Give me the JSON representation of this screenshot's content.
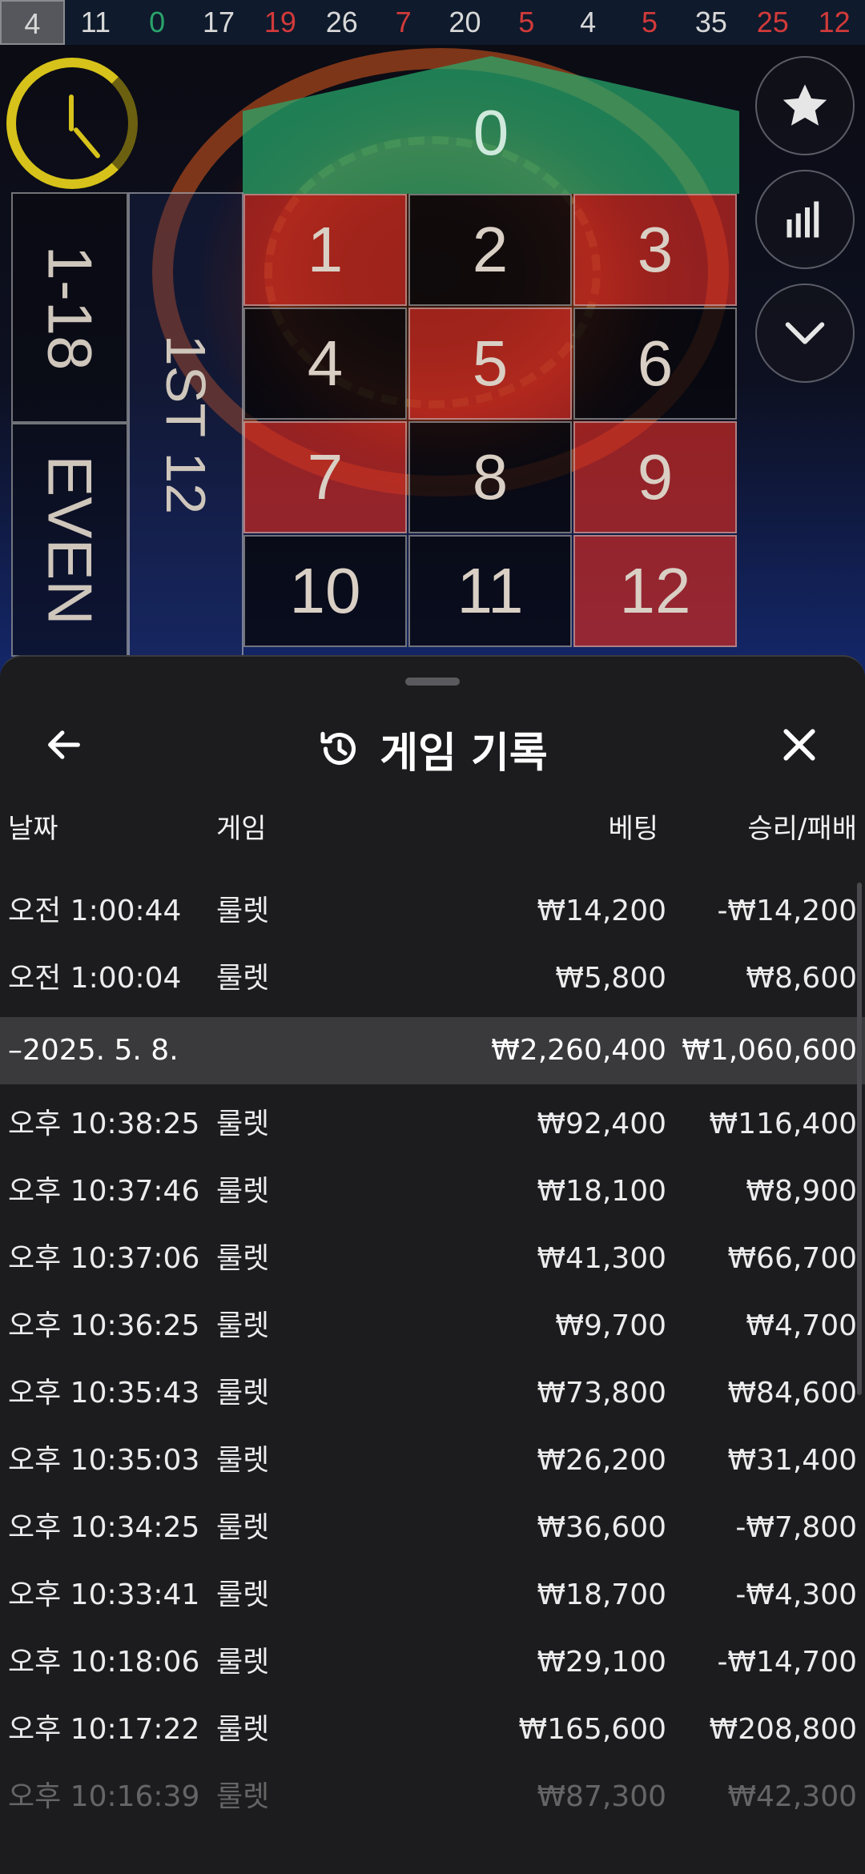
{
  "history": [
    "4",
    "11",
    "0",
    "17",
    "19",
    "26",
    "7",
    "20",
    "5",
    "4",
    "5",
    "35",
    "25",
    "12"
  ],
  "history_colors": [
    "#d8d8d8",
    "#d8d8d8",
    "#2aa36b",
    "#d8d8d8",
    "#d23a3a",
    "#d8d8d8",
    "#d23a3a",
    "#d8d8d8",
    "#d23a3a",
    "#d8d8d8",
    "#d23a3a",
    "#d8d8d8",
    "#d23a3a",
    "#d23a3a"
  ],
  "table": {
    "zero": "0",
    "n1": "1",
    "n2": "2",
    "n3": "3",
    "n4": "4",
    "n5": "5",
    "n6": "6",
    "n7": "7",
    "n8": "8",
    "n9": "9",
    "n10": "10",
    "n11": "11",
    "n12": "12",
    "low": "1-18",
    "even": "EVEN",
    "dozen": "1ST 12"
  },
  "icons": {
    "timer": "clock-icon",
    "favorite": "star-icon",
    "stats": "bar-chart-icon",
    "collapse": "chevron-down-icon",
    "back": "arrow-left-icon",
    "history": "history-icon",
    "close": "close-icon"
  },
  "sheet": {
    "title": "게임 기록",
    "columns": {
      "date": "날짜",
      "game": "게임",
      "bet": "베팅",
      "result": "승리/패배"
    }
  },
  "rows_top": [
    {
      "time": "오전 1:00:44",
      "game": "룰렛",
      "bet": "₩14,200",
      "result": "-₩14,200"
    },
    {
      "time": "오전 1:00:04",
      "game": "룰렛",
      "bet": "₩5,800",
      "result": "₩8,600"
    }
  ],
  "date_group": {
    "date": "–2025. 5. 8.",
    "bet_total": "₩2,260,400",
    "result_total": "₩1,060,600"
  },
  "rows": [
    {
      "time": "오후 10:38:25",
      "game": "룰렛",
      "bet": "₩92,400",
      "result": "₩116,400"
    },
    {
      "time": "오후 10:37:46",
      "game": "룰렛",
      "bet": "₩18,100",
      "result": "₩8,900"
    },
    {
      "time": "오후 10:37:06",
      "game": "룰렛",
      "bet": "₩41,300",
      "result": "₩66,700"
    },
    {
      "time": "오후 10:36:25",
      "game": "룰렛",
      "bet": "₩9,700",
      "result": "₩4,700"
    },
    {
      "time": "오후 10:35:43",
      "game": "룰렛",
      "bet": "₩73,800",
      "result": "₩84,600"
    },
    {
      "time": "오후 10:35:03",
      "game": "룰렛",
      "bet": "₩26,200",
      "result": "₩31,400"
    },
    {
      "time": "오후 10:34:25",
      "game": "룰렛",
      "bet": "₩36,600",
      "result": "-₩7,800"
    },
    {
      "time": "오후 10:33:41",
      "game": "룰렛",
      "bet": "₩18,700",
      "result": "-₩4,300"
    },
    {
      "time": "오후 10:18:06",
      "game": "룰렛",
      "bet": "₩29,100",
      "result": "-₩14,700"
    },
    {
      "time": "오후 10:17:22",
      "game": "룰렛",
      "bet": "₩165,600",
      "result": "₩208,800"
    },
    {
      "time": "오후 10:16:39",
      "game": "룰렛",
      "bet": "₩87,300",
      "result": "₩42,300"
    }
  ]
}
